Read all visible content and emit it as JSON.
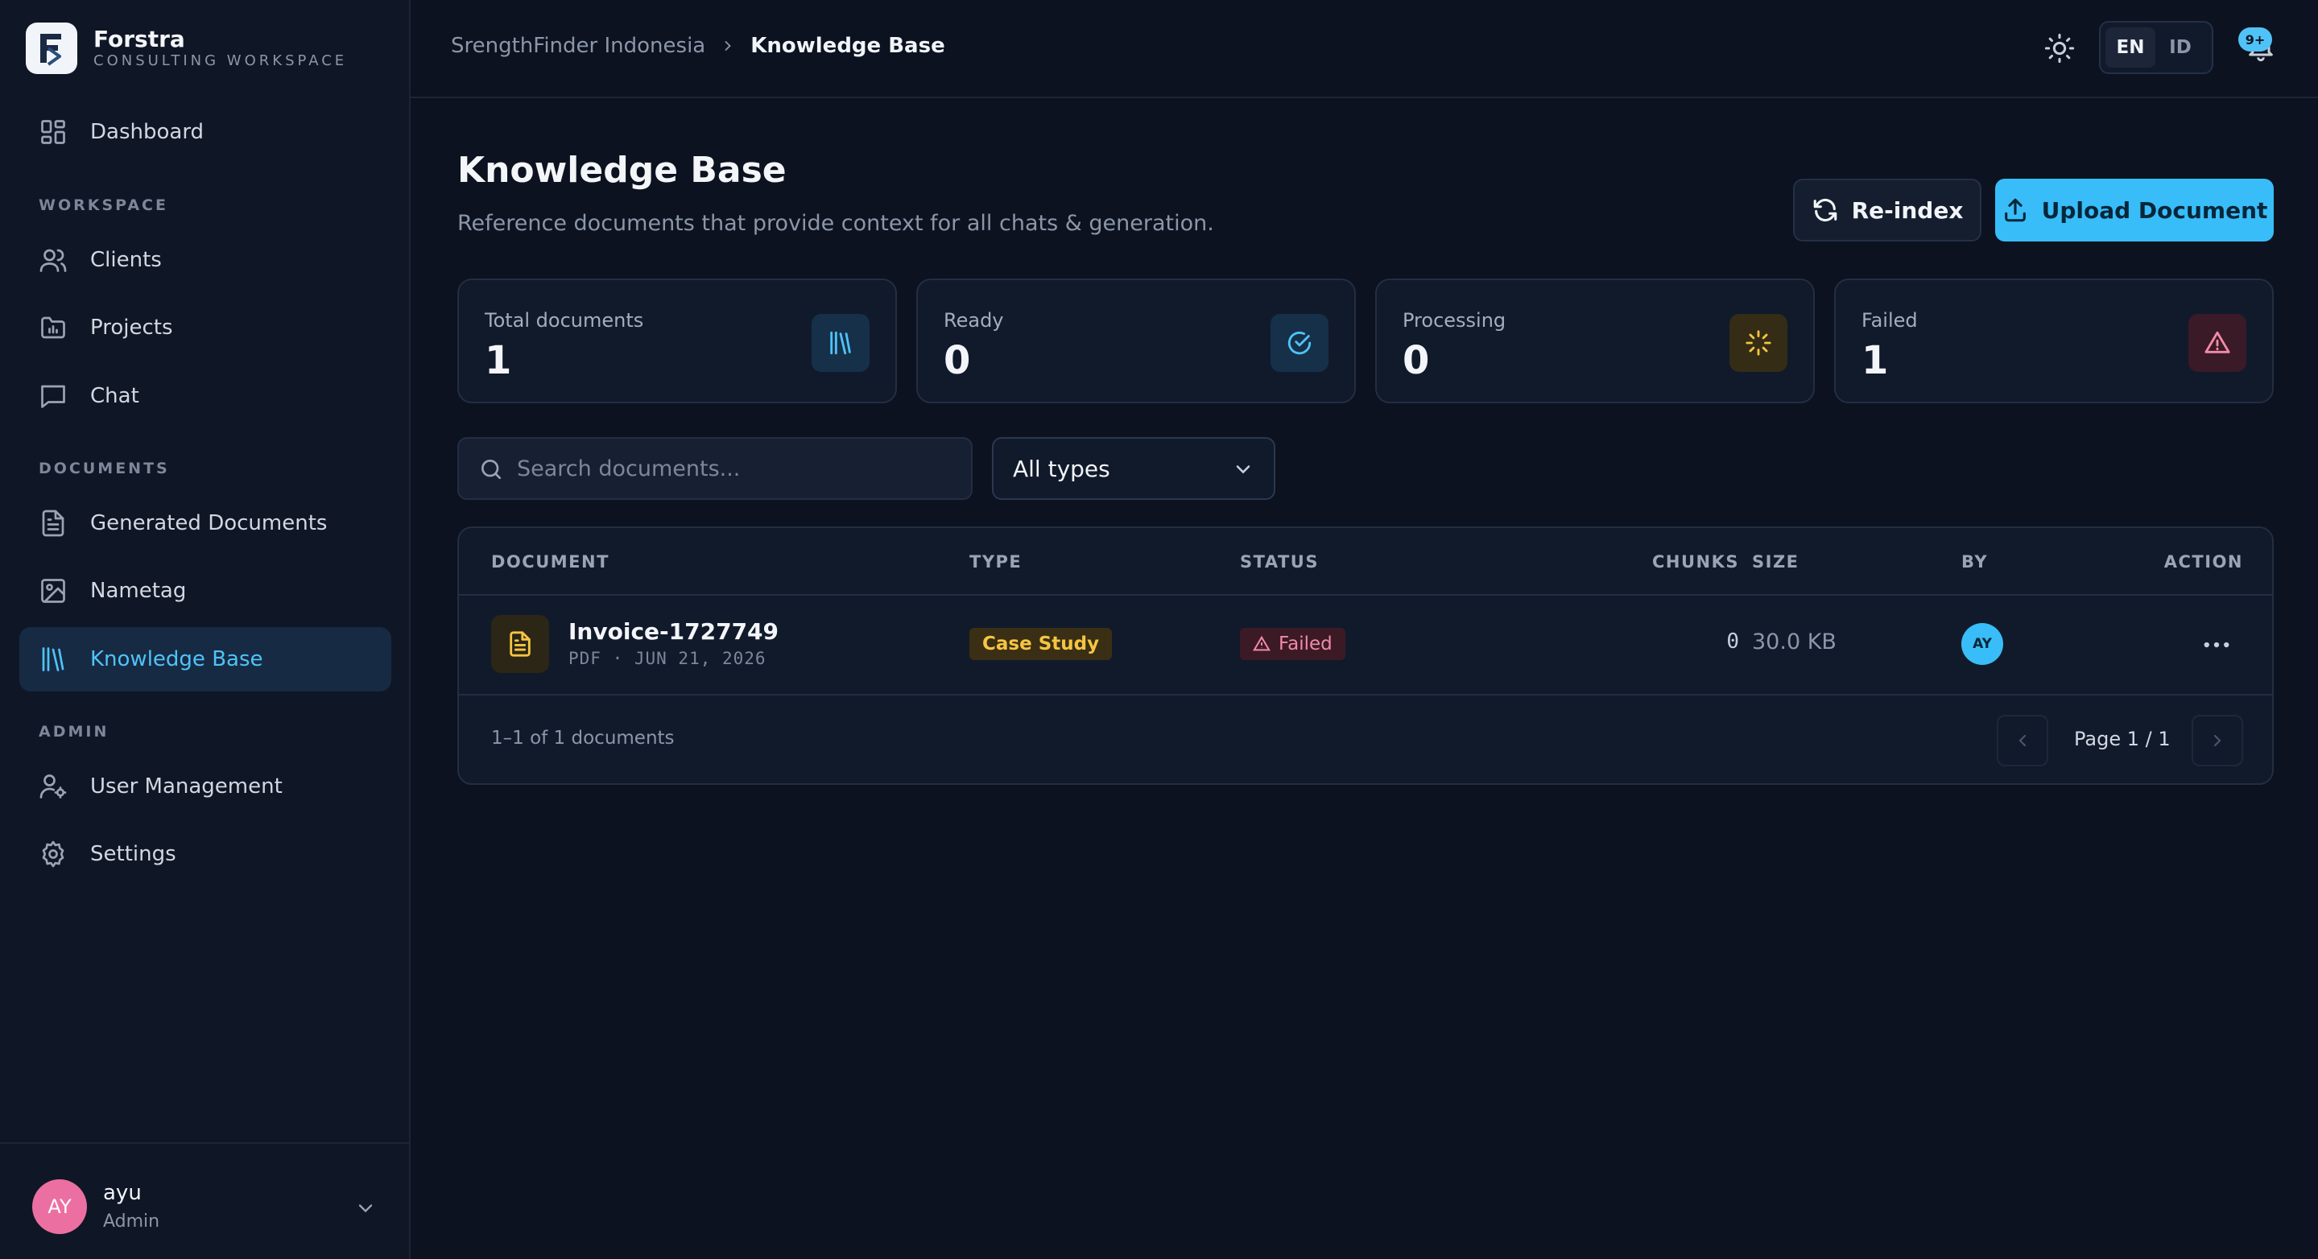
{
  "brand": {
    "name": "Forstra",
    "subtitle": "CONSULTING WORKSPACE"
  },
  "sidebar": {
    "items": [
      {
        "label": "Dashboard",
        "icon": "dashboard-icon"
      },
      {
        "label": "Clients",
        "icon": "users-icon"
      },
      {
        "label": "Projects",
        "icon": "folder-chart-icon"
      },
      {
        "label": "Chat",
        "icon": "chat-icon"
      },
      {
        "label": "Generated Documents",
        "icon": "document-icon"
      },
      {
        "label": "Nametag",
        "icon": "image-icon"
      },
      {
        "label": "Knowledge Base",
        "icon": "library-icon",
        "active": true
      },
      {
        "label": "User Management",
        "icon": "user-cog-icon"
      },
      {
        "label": "Settings",
        "icon": "gear-icon"
      }
    ],
    "sections": {
      "workspace": "WORKSPACE",
      "documents": "DOCUMENTS",
      "admin": "ADMIN"
    }
  },
  "user": {
    "initials": "AY",
    "name": "ayu",
    "role": "Admin",
    "avatar_color": "#ec6fa2"
  },
  "topbar": {
    "breadcrumb": [
      "SrengthFinder Indonesia",
      "Knowledge Base"
    ],
    "languages": [
      "EN",
      "ID"
    ],
    "active_language": "EN",
    "notification_badge": "9+"
  },
  "page": {
    "title": "Knowledge Base",
    "subtitle": "Reference documents that provide context for all chats & generation.",
    "reindex_label": "Re-index",
    "upload_label": "Upload Document"
  },
  "stats": [
    {
      "label": "Total documents",
      "value": "1",
      "icon": "library-icon",
      "color": "#4fc3f7"
    },
    {
      "label": "Ready",
      "value": "0",
      "icon": "check-circle-icon",
      "color": "#4fc3f7"
    },
    {
      "label": "Processing",
      "value": "0",
      "icon": "loader-icon",
      "color": "#f5c542"
    },
    {
      "label": "Failed",
      "value": "1",
      "icon": "alert-triangle-icon",
      "color": "#f28aa8"
    }
  ],
  "filters": {
    "search_placeholder": "Search documents...",
    "type_selected": "All types"
  },
  "table": {
    "headers": [
      "DOCUMENT",
      "TYPE",
      "STATUS",
      "CHUNKS",
      "SIZE",
      "BY",
      "ACTION"
    ],
    "rows": [
      {
        "name": "Invoice-1727749",
        "meta": "PDF · JUN 21, 2026",
        "type": "Case Study",
        "status": "Failed",
        "chunks": "0",
        "size": "30.0 KB",
        "by": "AY"
      }
    ],
    "count_text": "1–1 of 1 documents",
    "page_text": "Page 1 / 1"
  },
  "colors": {
    "accent": "#38bdf8",
    "background": "#0c1220",
    "panel": "#111a2b"
  }
}
